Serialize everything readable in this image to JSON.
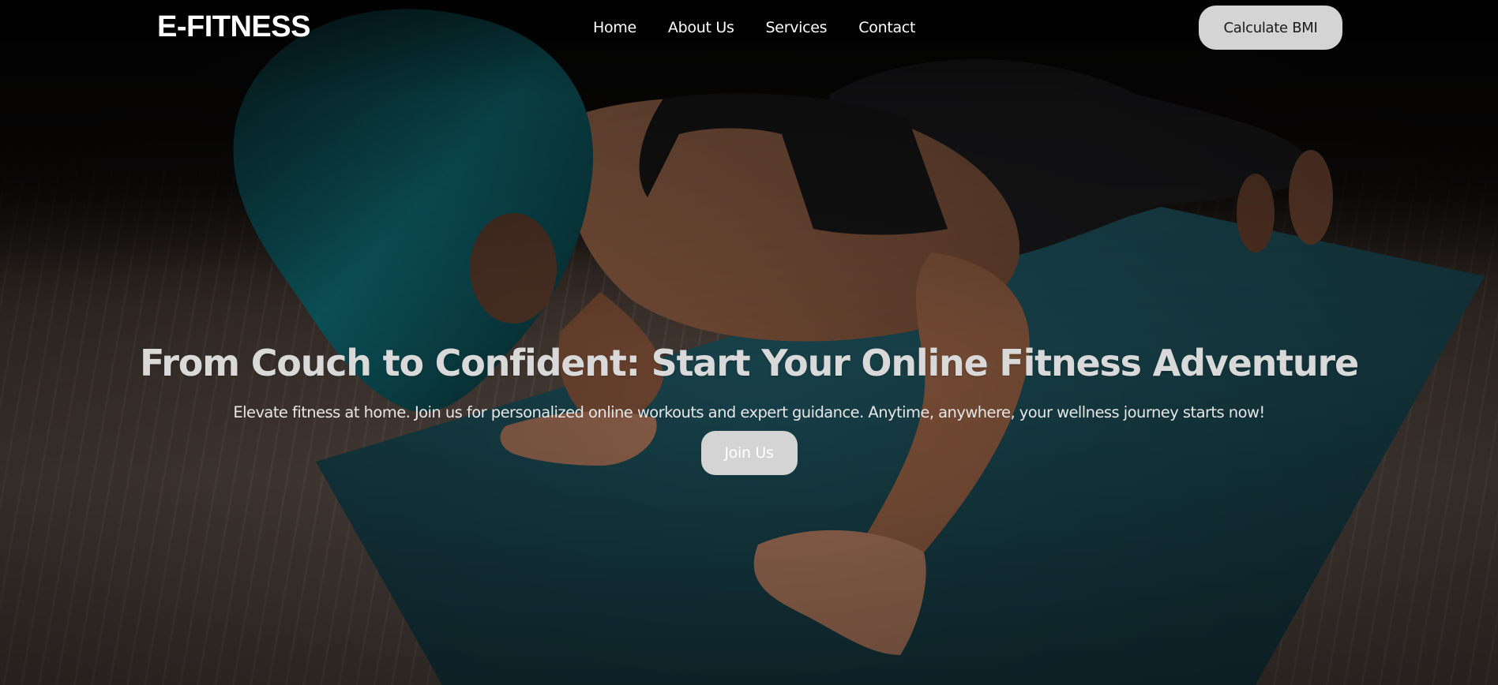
{
  "navbar": {
    "brand": "E-FITNESS",
    "links": [
      {
        "label": "Home"
      },
      {
        "label": "About Us"
      },
      {
        "label": "Services"
      },
      {
        "label": "Contact"
      }
    ],
    "cta_label": "Calculate BMI"
  },
  "hero": {
    "title": "From Couch to Confident: Start Your Online Fitness Adventure",
    "subtitle": "Elevate fitness at home. Join us for personalized online workouts and expert guidance. Anytime, anywhere, your wellness journey starts now!",
    "join_label": "Join Us"
  },
  "colors": {
    "button_bg": "#d4d4d4",
    "mat": "#1c4650",
    "hair_accent": "#0f7c86",
    "text_light": "#ffffff"
  }
}
